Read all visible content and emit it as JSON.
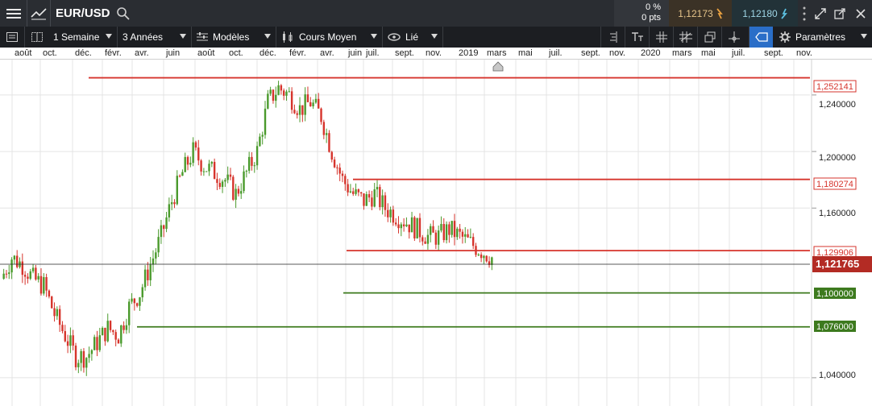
{
  "instrument": {
    "symbol": "EUR/USD",
    "change_pct": "0 %",
    "change_pts": "0 pts",
    "sell_price": "1,12173",
    "buy_price": "1,12180"
  },
  "toolbar": {
    "interval": "1 Semaine",
    "range": "3 Années",
    "templates": "Modèles",
    "study": "Cours Moyen",
    "link": "Lié",
    "settings": "Paramètres"
  },
  "time_axis": [
    "août",
    "oct.",
    "déc.",
    "févr.",
    "avr.",
    "juin",
    "août",
    "oct.",
    "déc.",
    "févr.",
    "avr.",
    "juin",
    "juil.",
    "sept.",
    "nov.",
    "2019",
    "mars",
    "mai",
    "juil.",
    "sept.",
    "nov.",
    "2020",
    "mars",
    "mai",
    "juil.",
    "sept.",
    "nov."
  ],
  "colors": {
    "up": "#4a9a2c",
    "down": "#d6342c",
    "header_bg": "#2a2d32",
    "toolbar_bg": "#1c1e22",
    "active_tool": "#2a6ec8"
  },
  "chart_data": {
    "type": "candlestick",
    "y_ticks": [
      "1,240000",
      "1,200000",
      "1,160000",
      "1,040000"
    ],
    "ylim": [
      1.02,
      1.265
    ],
    "current_price": "1,121765",
    "horizontal_lines": [
      {
        "label": "1,252141",
        "value": 1.252141,
        "color": "#d6342c",
        "from": "nov. 2016"
      },
      {
        "label": "1,180274",
        "value": 1.180274,
        "color": "#d6342c",
        "from": "juil. 2018"
      },
      {
        "label": "1,129906",
        "value": 1.129906,
        "color": "#d6342c",
        "from": "juin 2018"
      },
      {
        "label": "1,100000",
        "value": 1.1,
        "color": "#3d7a1e",
        "from": "juin 2018"
      },
      {
        "label": "1,076000",
        "value": 1.076,
        "color": "#3d7a1e",
        "from": "avr. 2017"
      }
    ],
    "close_path": [
      [
        1.11,
        1.125
      ],
      [
        1.125,
        1.12
      ],
      [
        1.12,
        1.11
      ],
      [
        1.11,
        1.105
      ],
      [
        1.105,
        1.085
      ],
      [
        1.085,
        1.07
      ],
      [
        1.07,
        1.055
      ],
      [
        1.055,
        1.055
      ],
      [
        1.055,
        1.065
      ],
      [
        1.065,
        1.075
      ],
      [
        1.075,
        1.07
      ],
      [
        1.07,
        1.09
      ],
      [
        1.09,
        1.1
      ],
      [
        1.1,
        1.12
      ],
      [
        1.12,
        1.14
      ],
      [
        1.14,
        1.165
      ],
      [
        1.165,
        1.185
      ],
      [
        1.185,
        1.2
      ],
      [
        1.2,
        1.19
      ],
      [
        1.19,
        1.185
      ],
      [
        1.185,
        1.18
      ],
      [
        1.18,
        1.17
      ],
      [
        1.17,
        1.185
      ],
      [
        1.185,
        1.2
      ],
      [
        1.2,
        1.235
      ],
      [
        1.235,
        1.245
      ],
      [
        1.245,
        1.24
      ],
      [
        1.24,
        1.23
      ],
      [
        1.23,
        1.235
      ],
      [
        1.235,
        1.225
      ],
      [
        1.225,
        1.2
      ],
      [
        1.2,
        1.18
      ],
      [
        1.18,
        1.17
      ],
      [
        1.17,
        1.165
      ],
      [
        1.165,
        1.17
      ],
      [
        1.17,
        1.16
      ],
      [
        1.16,
        1.155
      ],
      [
        1.155,
        1.15
      ],
      [
        1.15,
        1.145
      ],
      [
        1.145,
        1.14
      ],
      [
        1.14,
        1.14
      ],
      [
        1.14,
        1.145
      ],
      [
        1.145,
        1.14
      ],
      [
        1.14,
        1.135
      ],
      [
        1.135,
        1.13
      ],
      [
        1.13,
        1.125
      ]
    ]
  }
}
